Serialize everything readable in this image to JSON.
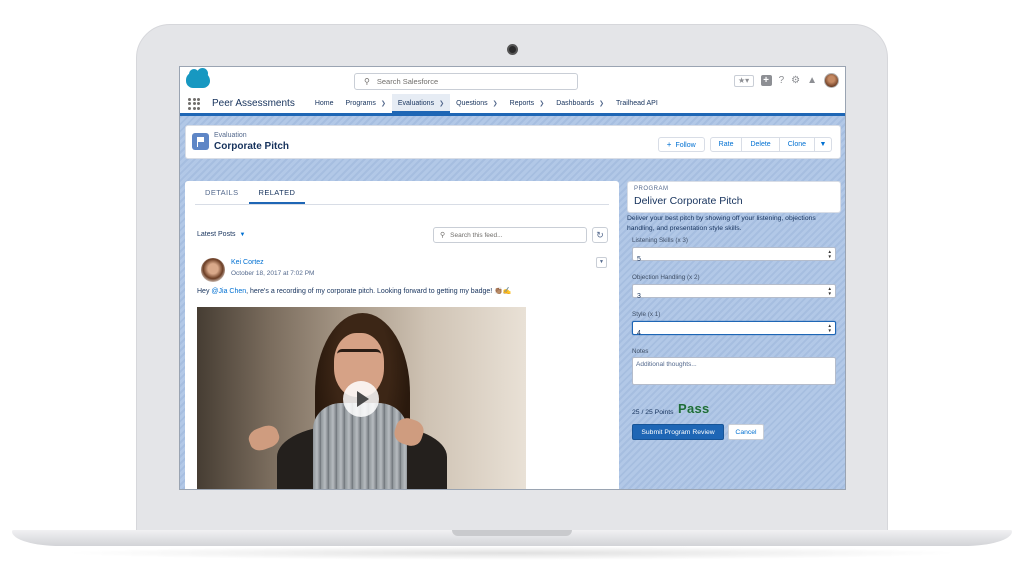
{
  "global_header": {
    "search_placeholder": "Search Salesforce",
    "icons": [
      "salesforce-logo",
      "favorites-star-icon",
      "add-icon",
      "help-icon",
      "setup-gear-icon",
      "notifications-bell-icon",
      "user-avatar"
    ]
  },
  "nav": {
    "app_name": "Peer Assessments",
    "items": [
      {
        "label": "Home",
        "has_menu": false
      },
      {
        "label": "Programs",
        "has_menu": true
      },
      {
        "label": "Evaluations",
        "has_menu": true,
        "active": true
      },
      {
        "label": "Questions",
        "has_menu": true
      },
      {
        "label": "Reports",
        "has_menu": true
      },
      {
        "label": "Dashboards",
        "has_menu": true
      },
      {
        "label": "Trailhead API",
        "has_menu": false
      }
    ]
  },
  "record": {
    "type_label": "Evaluation",
    "title": "Corporate Pitch",
    "actions": {
      "follow": "Follow",
      "rate": "Rate",
      "delete": "Delete",
      "clone": "Clone"
    }
  },
  "feed": {
    "tabs": {
      "details": "DETAILS",
      "related": "RELATED"
    },
    "sort_label": "Latest Posts",
    "search_placeholder": "Search this feed...",
    "post": {
      "author": "Kei Cortez",
      "timestamp": "October 18, 2017 at 7:02 PM",
      "body_prefix": "Hey ",
      "mention": "@Jia Chen",
      "body_suffix": ", here's a recording of my corporate pitch. Looking forward to getting my badge! 👏🏽✍️"
    }
  },
  "program": {
    "kicker": "PROGRAM",
    "title": "Deliver Corporate Pitch",
    "description": "Deliver your best pitch by showing off your listening, objections handling, and presentation style skills.",
    "fields": [
      {
        "label": "Listening Skills (x 3)",
        "value": "5"
      },
      {
        "label": "Objection Handling (x 2)",
        "value": "3"
      },
      {
        "label": "Style (x 1)",
        "value": "4"
      }
    ],
    "notes_label": "Notes",
    "notes_placeholder": "Additional thoughts...",
    "points_text": "25 / 25 Points",
    "result": "Pass",
    "submit_label": "Submit Program Review",
    "cancel_label": "Cancel"
  },
  "colors": {
    "brand_blue": "#1e66b5",
    "link_blue": "#0070d2",
    "pass_green": "#1d6b3a",
    "text_dark": "#16325c"
  }
}
